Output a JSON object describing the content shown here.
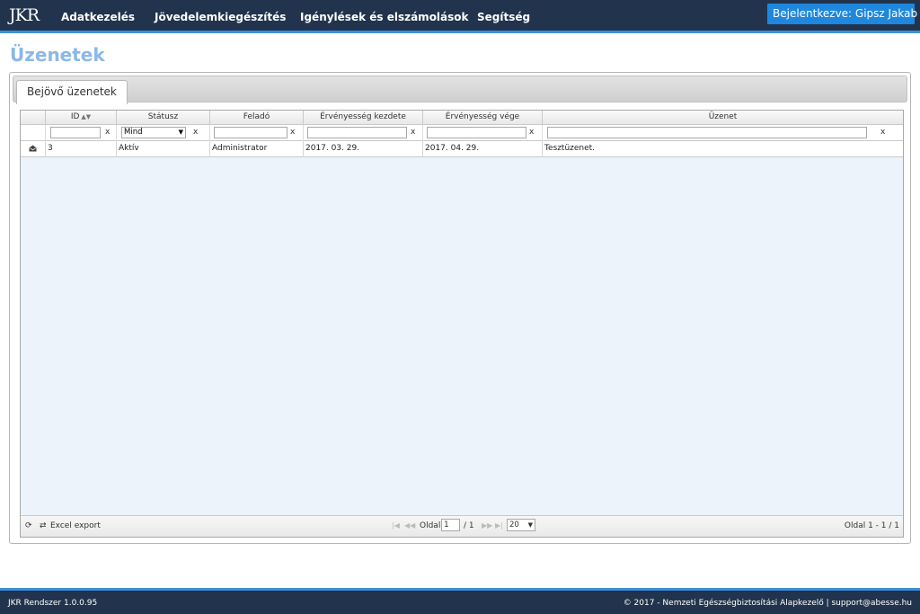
{
  "app": {
    "logo": "JKR",
    "nav": [
      "Adatkezelés",
      "Jövedelemkiegészítés",
      "Igénylések és elszámolások",
      "Segítség"
    ],
    "user_label": "Bejelentkezve: Gipsz Jakab",
    "user_caret": "▼"
  },
  "page": {
    "title": "Üzenetek",
    "tab_label": "Bejövő üzenetek"
  },
  "grid": {
    "columns": [
      "ID",
      "Státusz",
      "Feladó",
      "Érvényesség kezdete",
      "Érvényesség vége",
      "Üzenet"
    ],
    "sort_indicator": "▲▼",
    "filters": {
      "id": "",
      "status": "Mind",
      "sender": "",
      "valid_from": "",
      "valid_to": "",
      "message": "",
      "clear_label": "x"
    },
    "rows": [
      {
        "id": "3",
        "status": "Aktív",
        "sender": "Administrator",
        "valid_from": "2017. 03. 29.",
        "valid_to": "2017. 04. 29.",
        "message": "Tesztüzenet."
      }
    ],
    "footer": {
      "excel_label": "Excel export",
      "page_label": "Oldal",
      "page_value": "1",
      "page_total": "/ 1",
      "rows_per_page": "20",
      "summary": "Oldal 1 - 1 / 1"
    }
  },
  "footer": {
    "version": "JKR Rendszer 1.0.0.95",
    "copyright": "© 2017 - Nemzeti Egészségbiztosítási Alapkezelő | support@abesse.hu"
  },
  "colors": {
    "navbar_bg": "#22344d",
    "accent_blue": "#1f87dd",
    "title_blue": "#8ab8e8",
    "grid_bg": "#edf3fa"
  },
  "icons": {
    "message_row": "envelope-icon",
    "refresh": "refresh-icon",
    "export": "export-icon"
  }
}
